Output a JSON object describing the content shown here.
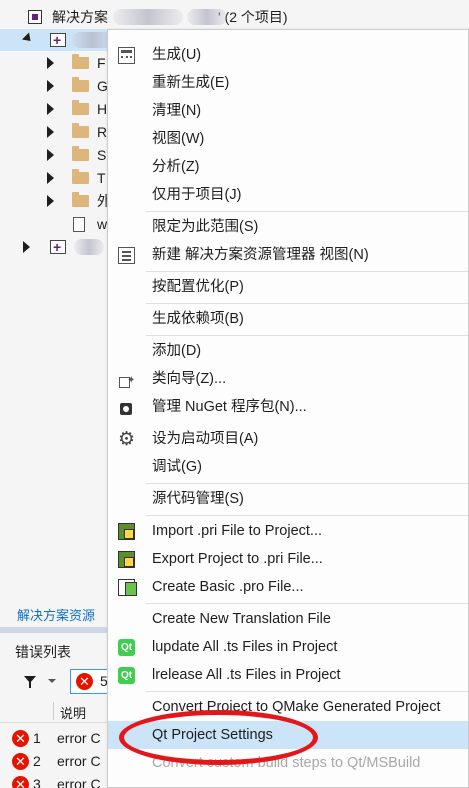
{
  "solution_explorer": {
    "solution_label_prefix": "解决方案",
    "solution_label_suffix": "' (2 个项目)",
    "folders": [
      "F",
      "G",
      "H",
      "R",
      "S",
      "T",
      "外"
    ],
    "file": "w",
    "tab_label": "解决方案资源"
  },
  "error_list": {
    "title": "错误列表",
    "filter_count": "5",
    "column_description": "说明",
    "rows": [
      {
        "num": "1",
        "text": "error C"
      },
      {
        "num": "2",
        "text": "error C"
      },
      {
        "num": "3",
        "text": "error C"
      }
    ]
  },
  "context_menu": {
    "items": [
      {
        "label": "生成(U)",
        "icon": "build-icon"
      },
      {
        "label": "重新生成(E)"
      },
      {
        "label": "清理(N)"
      },
      {
        "label": "视图(W)"
      },
      {
        "label": "分析(Z)"
      },
      {
        "label": "仅用于项目(J)"
      },
      {
        "label": "限定为此范围(S)"
      },
      {
        "label": "新建 解决方案资源管理器 视图(N)",
        "icon": "new-view-icon"
      },
      {
        "label": "按配置优化(P)"
      },
      {
        "label": "生成依赖项(B)"
      },
      {
        "label": "添加(D)"
      },
      {
        "label": "类向导(Z)...",
        "icon": "class-wizard-icon"
      },
      {
        "label": "管理 NuGet 程序包(N)...",
        "icon": "nuget-icon"
      },
      {
        "label": "设为启动项目(A)",
        "icon": "gear-icon"
      },
      {
        "label": "调试(G)"
      },
      {
        "label": "源代码管理(S)"
      },
      {
        "label": "Import .pri File to Project...",
        "icon": "import-pri-icon"
      },
      {
        "label": "Export Project to .pri File...",
        "icon": "export-pri-icon"
      },
      {
        "label": "Create Basic .pro File...",
        "icon": "create-pro-icon"
      },
      {
        "label": "Create New Translation File"
      },
      {
        "label": "lupdate All .ts Files in Project",
        "icon": "qt-icon"
      },
      {
        "label": "lrelease All .ts Files in Project",
        "icon": "qt-icon"
      },
      {
        "label": "Convert Project to QMake Generated Project"
      },
      {
        "label": "Qt Project Settings",
        "highlighted": true
      },
      {
        "label": "Convert custom build steps to Qt/MSBuild",
        "disabled": true
      },
      {
        "label": "...",
        "icon": "wrench-icon"
      }
    ]
  },
  "colors": {
    "highlight": "#cce4f7",
    "annotation": "#e3171a",
    "error": "#e51400",
    "qt_green": "#41cd52"
  }
}
